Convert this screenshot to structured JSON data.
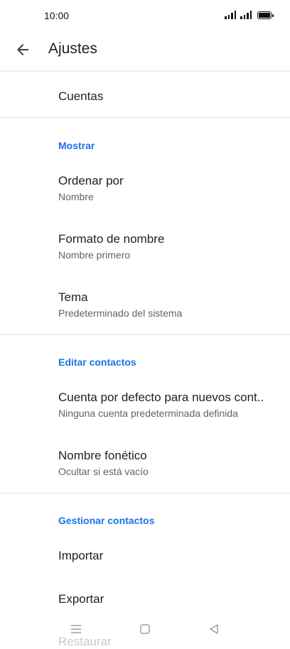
{
  "status_bar": {
    "time": "10:00"
  },
  "header": {
    "title": "Ajustes"
  },
  "accounts": {
    "label": "Cuentas"
  },
  "sections": {
    "display": {
      "title": "Mostrar",
      "sort": {
        "label": "Ordenar por",
        "value": "Nombre"
      },
      "name_format": {
        "label": "Formato de nombre",
        "value": "Nombre primero"
      },
      "theme": {
        "label": "Tema",
        "value": "Predeterminado del sistema"
      }
    },
    "edit": {
      "title": "Editar contactos",
      "default_account": {
        "label": "Cuenta por defecto para nuevos cont..",
        "value": "Ninguna cuenta predeterminada definida"
      },
      "phonetic": {
        "label": "Nombre fonético",
        "value": "Ocultar si está vacío"
      }
    },
    "manage": {
      "title": "Gestionar contactos",
      "import": {
        "label": "Importar"
      },
      "export": {
        "label": "Exportar"
      },
      "restore": {
        "label": "Restaurar"
      }
    }
  },
  "colors": {
    "accent": "#1a73e8",
    "text": "#202124",
    "secondary_text": "#5f6368",
    "divider": "#e0e0e0"
  }
}
